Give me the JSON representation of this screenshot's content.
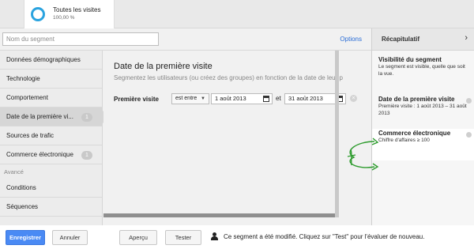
{
  "segment_chip": {
    "name": "Toutes les visites",
    "percent": "100,00 %"
  },
  "search": {
    "placeholder": "Nom du segment"
  },
  "options_label": "Options",
  "sidebar": {
    "items": [
      {
        "label": "Données démographiques"
      },
      {
        "label": "Technologie"
      },
      {
        "label": "Comportement"
      },
      {
        "label": "Date de la première vi...",
        "badge": "1"
      },
      {
        "label": "Sources de trafic"
      },
      {
        "label": "Commerce électronique",
        "badge": "1"
      }
    ],
    "section_label": "Avancé",
    "advanced_items": [
      {
        "label": "Conditions"
      },
      {
        "label": "Séquences"
      }
    ]
  },
  "main": {
    "title": "Date de la première visite",
    "description": "Segmentez les utilisateurs (ou créez des groupes) en fonction de la date de leur p",
    "condition_label": "Première visite",
    "operator": "est entre",
    "date_start": "1 août 2013",
    "and_label": "et",
    "date_end": "31 août 2013"
  },
  "summary": {
    "title": "Récapitulatif",
    "visibility_title": "Visibilité du segment",
    "visibility_desc": "Le segment est visible, quelle que soit la vue.",
    "date_title": "Date de la première visite",
    "date_desc": "Première visite : 1 août 2013 – 31 août 2013",
    "ecom_title": "Commerce électronique",
    "ecom_desc": "Chiffre d'affaires ≥ 100"
  },
  "footer": {
    "save_label": "Enregistrer",
    "cancel_label": "Annuler",
    "preview_label": "Aperçu",
    "test_label": "Tester",
    "message": "Ce segment a été modifié. Cliquez sur \"Test\" pour l'évaluer de nouveau."
  },
  "colors": {
    "accent": "#4a8af4",
    "link": "#2a6dd6",
    "ring": "#2aa3df",
    "annotation": "#2d9b2d"
  }
}
